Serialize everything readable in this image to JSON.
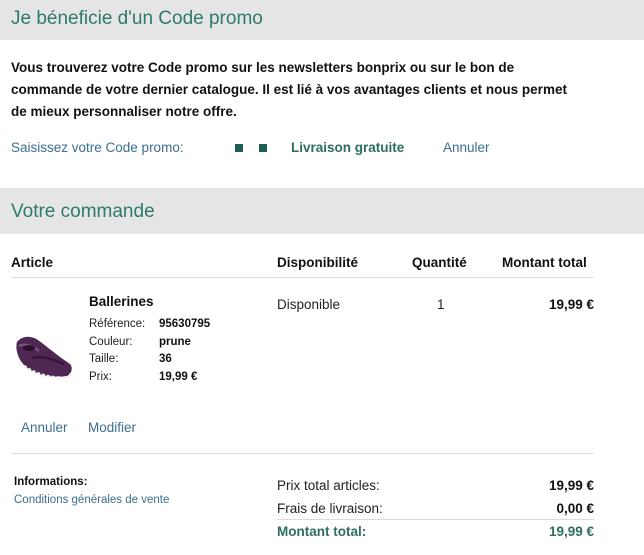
{
  "promo": {
    "title": "Je béneficie d'un Code promo",
    "description": "Vous trouverez votre Code promo sur les newsletters bonprix ou sur le bon de commande de votre dernier catalogue. Il est lié à vos avantages clients et nous permet de mieux personnaliser notre offre.",
    "input_label": "Saisissez votre Code promo:",
    "applied_value": "Livraison gratuite",
    "cancel_label": "Annuler"
  },
  "order": {
    "title": "Votre commande",
    "columns": {
      "article": "Article",
      "availability": "Disponibilité",
      "quantity": "Quantité",
      "total": "Montant total"
    },
    "item": {
      "name": "Ballerines",
      "image_icon": "purple-ballerina-shoe",
      "reference_label": "Référence:",
      "reference": "95630795",
      "color_label": "Couleur:",
      "color": "prune",
      "size_label": "Taille:",
      "size": "36",
      "price_label": "Prix:",
      "price": "19,99 €",
      "availability": "Disponible",
      "quantity": "1",
      "total": "19,99 €",
      "cancel_label": "Annuler",
      "edit_label": "Modifier"
    },
    "info": {
      "title": "Informations:",
      "terms_link": "Conditions générales de vente"
    },
    "summary": {
      "subtotal_label": "Prix total articles:",
      "subtotal": "19,99 €",
      "shipping_label": "Frais de livraison:",
      "shipping": "0,00 €",
      "grand_total_label": "Montant total:",
      "grand_total": "19,99 €"
    }
  },
  "colors": {
    "accent": "#2d7a6e",
    "link": "#3b6e8f",
    "header_bg": "#e5e5e5"
  }
}
